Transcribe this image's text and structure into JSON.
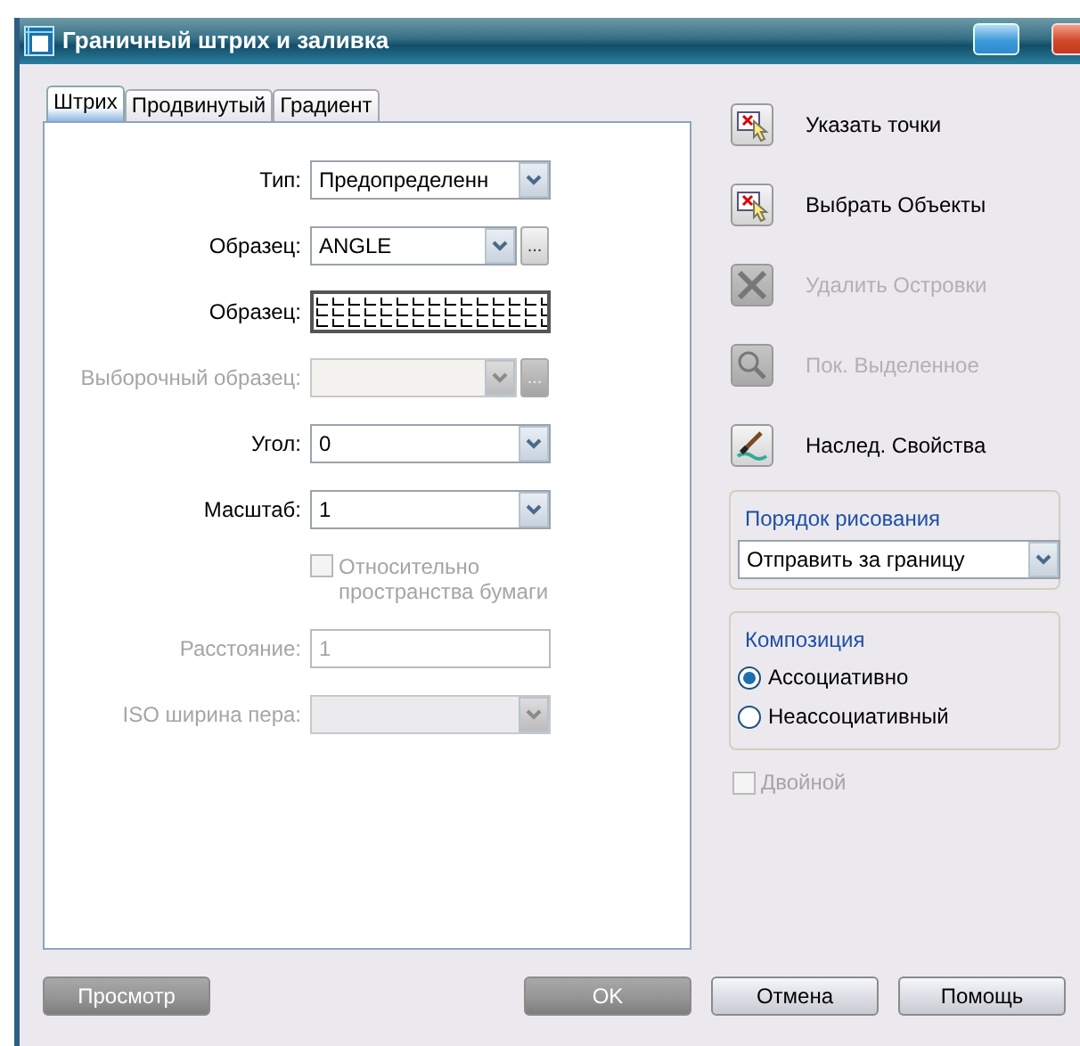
{
  "window": {
    "title": "Граничный штрих и заливка"
  },
  "tabs": [
    {
      "label": "Штрих",
      "selected": true
    },
    {
      "label": "Продвинутый",
      "selected": false
    },
    {
      "label": "Градиент",
      "selected": false
    }
  ],
  "fields": [
    {
      "kind": "combo",
      "label": "Тип:",
      "value": "Предопределенн",
      "disabled": false
    },
    {
      "kind": "combo_browse",
      "label": "Образец:",
      "value": "ANGLE",
      "browse": "...",
      "disabled": false
    },
    {
      "kind": "pattern",
      "label": "Образец:",
      "disabled": false
    },
    {
      "kind": "combo_browse",
      "label": "Выборочный образец:",
      "browse": "...",
      "disabled": true
    },
    {
      "kind": "combo",
      "label": "Угол:",
      "value": "0",
      "disabled": false
    },
    {
      "kind": "combo",
      "label": "Масштаб:",
      "value": "1",
      "disabled": false
    },
    {
      "kind": "checkbox",
      "label": "Относительно пространства бумаги",
      "checked": false,
      "disabled": true
    },
    {
      "kind": "input",
      "label": "Расстояние:",
      "value": "1",
      "disabled": true
    },
    {
      "kind": "combo",
      "label": "ISO ширина пера:",
      "disabled": true
    }
  ],
  "actions": [
    {
      "kind": "pick",
      "label": "Указать точки",
      "disabled": false
    },
    {
      "kind": "select",
      "label": "Выбрать Объекты",
      "disabled": false
    },
    {
      "kind": "remove",
      "label": "Удалить Островки",
      "disabled": true
    },
    {
      "kind": "view",
      "label": "Пок. Выделенное",
      "disabled": true
    },
    {
      "kind": "inherit",
      "label": "Наслед. Свойства",
      "disabled": false
    }
  ],
  "draw_order": {
    "title": "Порядок рисования",
    "value": "Отправить за границу"
  },
  "composition": {
    "title": "Композиция",
    "options": [
      {
        "label": "Ассоциативно",
        "selected": true
      },
      {
        "label": "Неассоциативный",
        "selected": false
      }
    ]
  },
  "double": {
    "label": "Двойной",
    "checked": false,
    "disabled": true
  },
  "buttons": [
    {
      "label": "Просмотр",
      "disabled": true
    },
    {
      "label": "OK",
      "disabled": true
    },
    {
      "label": "Отмена",
      "disabled": false
    },
    {
      "label": "Помощь",
      "disabled": false
    }
  ]
}
